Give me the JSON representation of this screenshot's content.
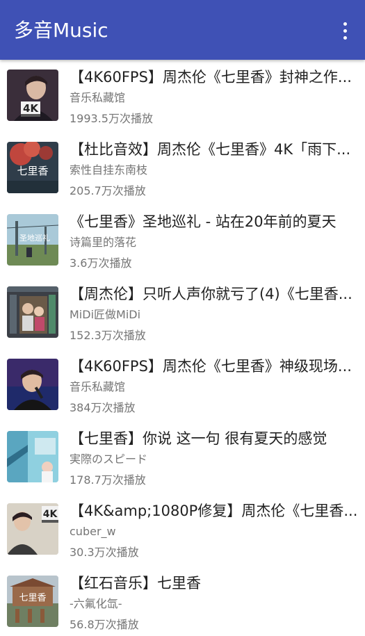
{
  "app": {
    "title": "多音Music",
    "menu_icon": "more-vert-icon"
  },
  "colors": {
    "appbar": "#3f51b5",
    "title_text": "#212121",
    "secondary_text": "#757575"
  },
  "videos": [
    {
      "title": "【4K60FPS】周杰伦《七里香》封神之作...",
      "author": "音乐私藏馆",
      "plays": "1993.5万次播放",
      "thumb_text": "4K"
    },
    {
      "title": "【杜比音效】周杰伦《七里香》4K「雨下...",
      "author": "索性自挂东南枝",
      "plays": "205.7万次播放",
      "thumb_text": "七里香"
    },
    {
      "title": "《七里香》圣地巡礼 - 站在20年前的夏天",
      "author": "诗篇里的落花",
      "plays": "3.6万次播放",
      "thumb_text": "圣地巡礼"
    },
    {
      "title": "【周杰伦】只听人声你就亏了(4)《七里香...",
      "author": "MiDi匠做MiDi",
      "plays": "152.3万次播放",
      "thumb_text": ""
    },
    {
      "title": "【4K60FPS】周杰伦《七里香》神级现场...",
      "author": "音乐私藏馆",
      "plays": "384万次播放",
      "thumb_text": ""
    },
    {
      "title": "【七里香】你说  这一句  很有夏天的感觉",
      "author": "実際のスピード",
      "plays": "178.7万次播放",
      "thumb_text": ""
    },
    {
      "title": "【4K&amp;1080P修复】周杰伦《七里香...",
      "author": "cuber_w",
      "plays": "30.3万次播放",
      "thumb_text": "4K"
    },
    {
      "title": "【红石音乐】七里香",
      "author": "-六氟化氙-",
      "plays": "56.8万次播放",
      "thumb_text": "七里香"
    }
  ]
}
